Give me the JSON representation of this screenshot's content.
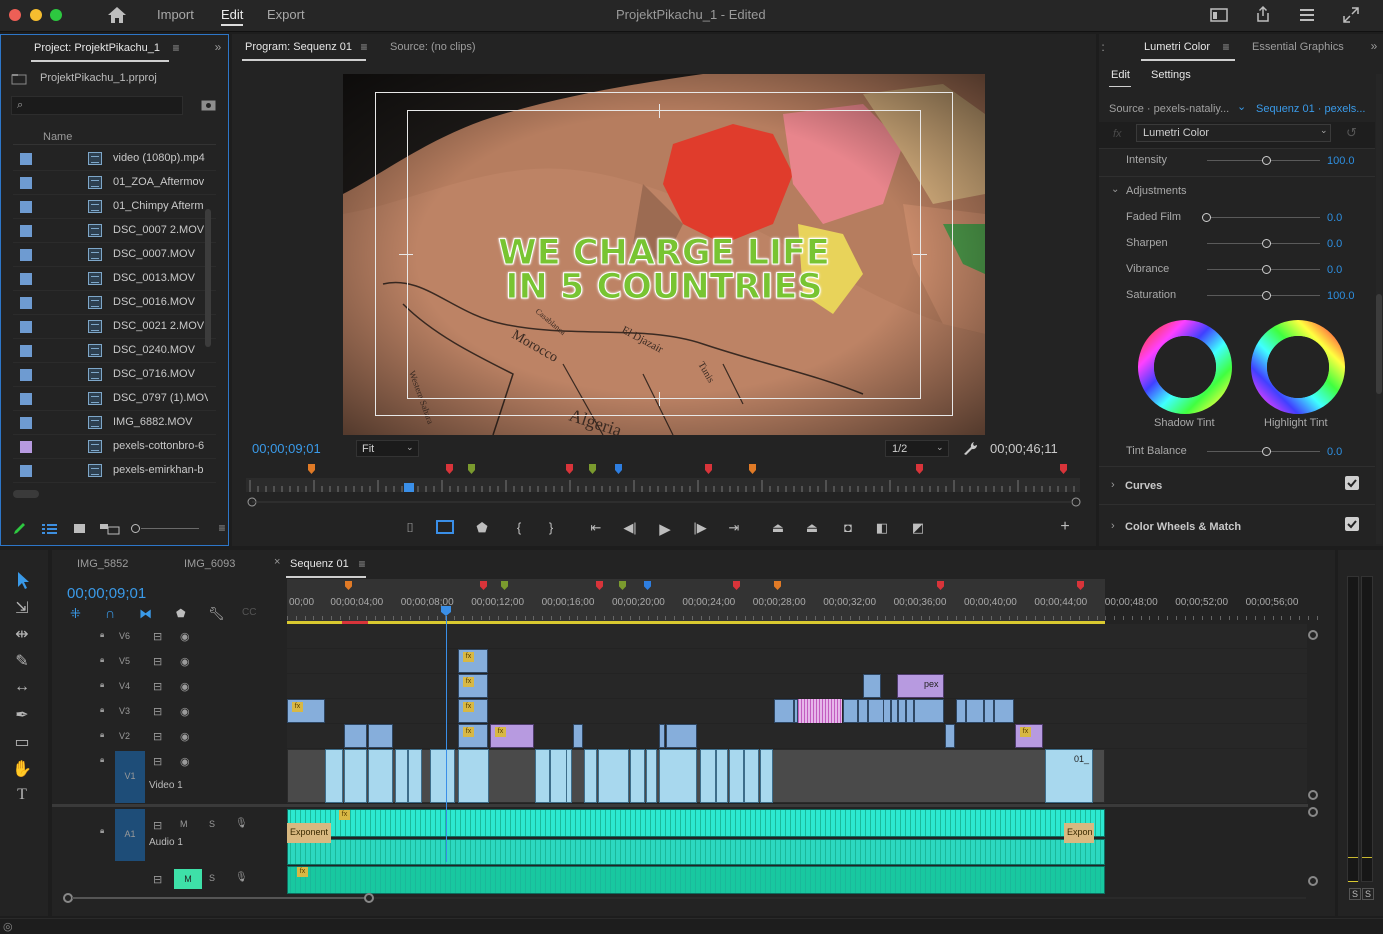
{
  "app": {
    "window_title": "ProjektPikachu_1 - Edited",
    "nav": [
      "Import",
      "Edit",
      "Export"
    ],
    "active_nav": "Edit"
  },
  "project_panel": {
    "tab_label": "Project: ProjektPikachu_1",
    "project_file": "ProjektPikachu_1.prproj",
    "search_placeholder": "",
    "column_header": "Name",
    "items": [
      {
        "name": "video (1080p).mp4",
        "color": "#6e9bd1"
      },
      {
        "name": "01_ZOA_Aftermov",
        "color": "#6e9bd1"
      },
      {
        "name": "01_Chimpy Afterm",
        "color": "#6e9bd1"
      },
      {
        "name": "DSC_0007 2.MOV",
        "color": "#6e9bd1"
      },
      {
        "name": "DSC_0007.MOV",
        "color": "#6e9bd1"
      },
      {
        "name": "DSC_0013.MOV",
        "color": "#6e9bd1"
      },
      {
        "name": "DSC_0016.MOV",
        "color": "#6e9bd1"
      },
      {
        "name": "DSC_0021 2.MOV",
        "color": "#6e9bd1"
      },
      {
        "name": "DSC_0240.MOV",
        "color": "#6e9bd1"
      },
      {
        "name": "DSC_0716.MOV",
        "color": "#6e9bd1"
      },
      {
        "name": "DSC_0797 (1).MOV",
        "color": "#6e9bd1"
      },
      {
        "name": "IMG_6882.MOV",
        "color": "#6e9bd1"
      },
      {
        "name": "pexels-cottonbro-6",
        "color": "#b79ae0"
      },
      {
        "name": "pexels-emirkhan-b",
        "color": "#6e9bd1"
      }
    ]
  },
  "program_monitor": {
    "tab_label": "Program: Sequenz 01",
    "source_tab_label": "Source: (no clips)",
    "overlay_text_line1": "WE CHARGE LIFE",
    "overlay_text_line2": "IN 5 COUNTRIES",
    "map_labels": [
      "Morocco",
      "Algeria",
      "El Djazair",
      "Tunis",
      "Western Sahara",
      "Casablanca"
    ],
    "current_timecode": "00;00;09;01",
    "zoom": "Fit",
    "resolution": "1/2",
    "duration": "00;00;46;11",
    "marker_colors": [
      "#e07a26",
      "#d8343a",
      "#7a9a2e",
      "#d8343a",
      "#7a9a2e",
      "#2e7ee0",
      "#d8343a",
      "#e07a26",
      "#d8343a",
      "#d8343a"
    ]
  },
  "lumetri": {
    "tab_label": "Lumetri Color",
    "other_tab": "Essential Graphics",
    "subtabs": [
      "Edit",
      "Settings"
    ],
    "source_label": "Source · pexels-nataliy...",
    "sequence_label": "Sequenz 01 · pexels...",
    "effect_select": "Lumetri Color",
    "intensity_label": "Intensity",
    "intensity_value": "100.0",
    "adjustments_label": "Adjustments",
    "sliders": [
      {
        "label": "Faded Film",
        "value": "0.0",
        "pos": 0.0
      },
      {
        "label": "Sharpen",
        "value": "0.0",
        "pos": 0.5
      },
      {
        "label": "Vibrance",
        "value": "0.0",
        "pos": 0.5
      },
      {
        "label": "Saturation",
        "value": "100.0",
        "pos": 0.5
      }
    ],
    "shadow_tint_label": "Shadow Tint",
    "highlight_tint_label": "Highlight Tint",
    "tint_balance_label": "Tint Balance",
    "tint_balance_value": "0.0",
    "curves_label": "Curves",
    "color_wheels_label": "Color Wheels & Match"
  },
  "timeline": {
    "tabs": [
      "IMG_5852",
      "IMG_6093",
      "Sequenz 01"
    ],
    "active_tab": "Sequenz 01",
    "timecode": "00;00;09;01",
    "ruler_labels": [
      "00;00",
      "00;00;04;00",
      "00;00;08;00",
      "00;00;12;00",
      "00;00;16;00",
      "00;00;20;00",
      "00;00;24;00",
      "00;00;28;00",
      "00;00;32;00",
      "00;00;36;00",
      "00;00;40;00",
      "00;00;44;00",
      "00;00;48;00",
      "00;00;52;00",
      "00;00;56;00"
    ],
    "video_tracks": [
      "V6",
      "V5",
      "V4",
      "V3",
      "V2",
      "V1"
    ],
    "video1_name": "Video 1",
    "audio_track": "A1",
    "audio1_name": "Audio 1",
    "audio_buttons": [
      "M",
      "S"
    ],
    "transition_left": "Exponent",
    "transition_right": "Expon",
    "clip_label_pex": "pex",
    "clip_label_01": "01_",
    "meter_buttons": [
      "S",
      "S"
    ]
  }
}
